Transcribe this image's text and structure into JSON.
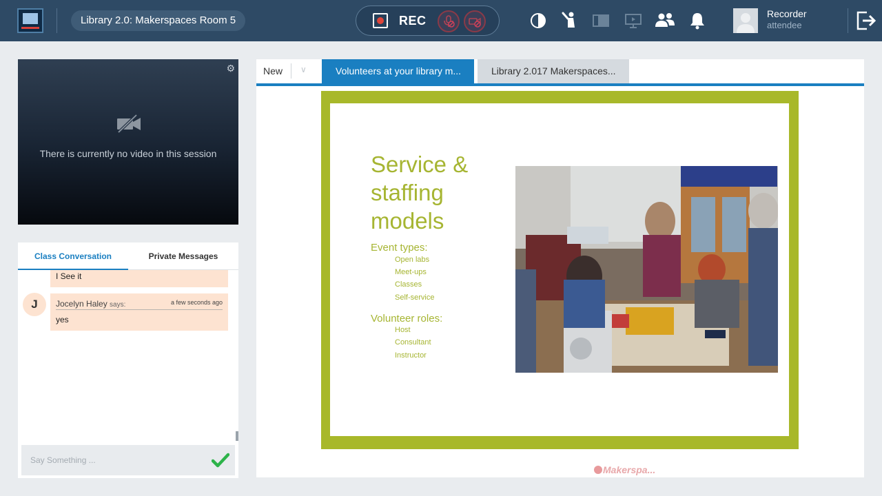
{
  "header": {
    "session_title": "Library 2.0: Makerspaces Room 5",
    "rec_label": "REC",
    "user": {
      "name": "Recorder",
      "role": "attendee"
    }
  },
  "video": {
    "message": "There is currently no video in this session"
  },
  "chat": {
    "tabs": [
      {
        "label": "Class Conversation",
        "active": true
      },
      {
        "label": "Private Messages",
        "active": false
      }
    ],
    "messages": [
      {
        "text": "I See it"
      },
      {
        "initial": "J",
        "author": "Jocelyn Haley",
        "says": "says:",
        "time": "a few seconds ago",
        "text": "yes"
      }
    ],
    "input_placeholder": "Say Something ..."
  },
  "content": {
    "new_label": "New",
    "tabs": [
      {
        "label": "Volunteers at your library m...",
        "active": true
      },
      {
        "label": "Library 2.017 Makerspaces...",
        "active": false
      }
    ],
    "slide": {
      "title": "Service & staffing models",
      "sections": [
        {
          "heading": "Event types:",
          "items": [
            "Open labs",
            "Meet-ups",
            "Classes",
            "Self-service"
          ]
        },
        {
          "heading": "Volunteer roles:",
          "items": [
            "Host",
            "Consultant",
            "Instructor"
          ]
        }
      ]
    },
    "watermark": "Makerspa..."
  },
  "colors": {
    "topbar": "#2e4a65",
    "accent": "#1a7fc1",
    "slide_border": "#a8b82a",
    "slide_text": "#a6b532",
    "chat_bubble": "#fde3d1",
    "rec_dot": "#e0453a",
    "send": "#2db34a"
  },
  "icons": [
    "app-logo-icon",
    "mic-muted-icon",
    "camera-muted-icon",
    "contrast-icon",
    "raise-hand-icon",
    "layout-icon",
    "screen-share-icon",
    "participants-icon",
    "notification-bell-icon",
    "exit-icon",
    "gear-icon",
    "no-video-icon",
    "send-check-icon",
    "chevron-down-icon"
  ]
}
